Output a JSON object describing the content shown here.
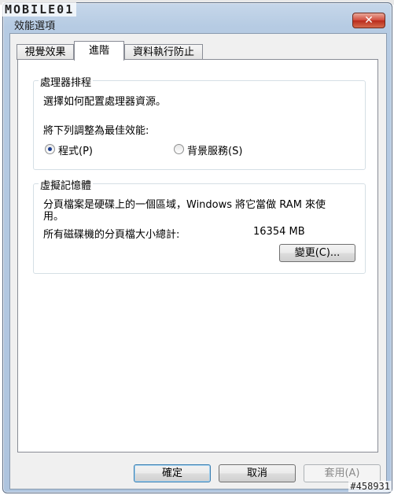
{
  "window": {
    "logo": "MOBILE01",
    "title": "效能選項",
    "close_label": "✕"
  },
  "tabs": [
    {
      "label": "視覺效果",
      "active": false
    },
    {
      "label": "進階",
      "active": true
    },
    {
      "label": "資料執行防止",
      "active": false
    }
  ],
  "processor": {
    "group_title": "處理器排程",
    "description": "選擇如何配置處理器資源。",
    "adjust_label": "將下列調整為最佳效能:",
    "options": [
      {
        "label": "程式(P)",
        "selected": true
      },
      {
        "label": "背景服務(S)",
        "selected": false
      }
    ]
  },
  "virtual_memory": {
    "group_title": "虛擬記憶體",
    "description_line1": "分頁檔案是硬碟上的一個區域，Windows 將它當做 RAM 來使",
    "description_line2": "用。",
    "total_label": "所有磁碟機的分頁檔大小總計:",
    "total_value": "16354 MB",
    "change_button": "變更(C)..."
  },
  "footer": {
    "ok": "確定",
    "cancel": "取消",
    "apply": "套用(A)"
  },
  "watermark": "#458931",
  "colors": {
    "selected_radio": "#1c3d8f",
    "close_button": "#c7402f"
  }
}
